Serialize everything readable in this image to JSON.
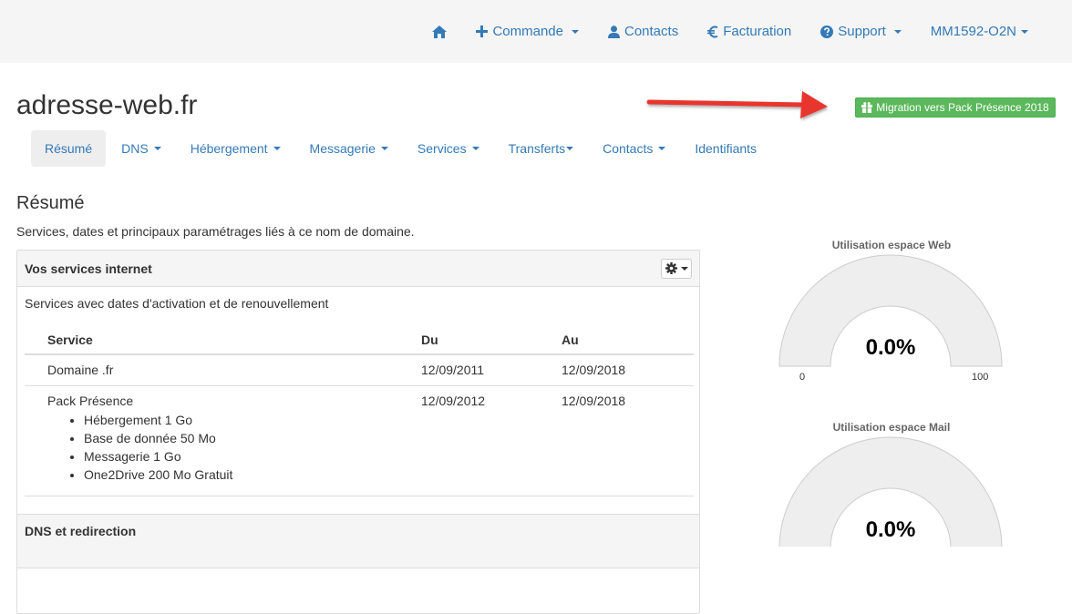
{
  "navbar": {
    "items": [
      {
        "label": "",
        "icon": "home-icon"
      },
      {
        "label": "Commande",
        "icon": "plus-icon",
        "dropdown": true
      },
      {
        "label": "Contacts",
        "icon": "user-icon"
      },
      {
        "label": "Facturation",
        "icon": "euro-icon"
      },
      {
        "label": "Support",
        "icon": "question-circle-icon",
        "dropdown": true
      },
      {
        "label": "MM1592-O2N",
        "dropdown": true
      }
    ]
  },
  "domain": {
    "title": "adresse-web.fr",
    "migration_button": "Migration vers Pack Présence 2018"
  },
  "tabs": [
    {
      "label": "Résumé",
      "active": true
    },
    {
      "label": "DNS",
      "dropdown": true
    },
    {
      "label": "Hébergement",
      "dropdown": true
    },
    {
      "label": "Messagerie",
      "dropdown": true
    },
    {
      "label": "Services",
      "dropdown": true
    },
    {
      "label": "Transferts",
      "dropdown": true
    },
    {
      "label": "Contacts",
      "dropdown": true
    },
    {
      "label": "Identifiants"
    }
  ],
  "summary": {
    "title": "Résumé",
    "description": "Services, dates et principaux paramétrages liés à ce nom de domaine."
  },
  "services_panel": {
    "title": "Vos services internet",
    "description": "Services avec dates d'activation et de renouvellement",
    "columns": [
      "Service",
      "Du",
      "Au"
    ],
    "rows": [
      {
        "service": "Domaine .fr",
        "du": "12/09/2011",
        "au": "12/09/2018",
        "items": []
      },
      {
        "service": "Pack Présence",
        "du": "12/09/2012",
        "au": "12/09/2018",
        "items": [
          "Hébergement 1 Go",
          "Base de donnée 50 Mo",
          "Messagerie 1 Go",
          "One2Drive 200 Mo Gratuit"
        ]
      }
    ]
  },
  "dns_panel": {
    "title": "DNS et redirection"
  },
  "gauges": [
    {
      "title": "Utilisation espace Web",
      "value": "0.0%",
      "value_num": 0,
      "min": "0",
      "max": "100"
    },
    {
      "title": "Utilisation espace Mail",
      "value": "0.0%",
      "value_num": 0
    }
  ],
  "colors": {
    "link": "#337ab7",
    "success": "#5cb85c",
    "arrow": "#e8342e",
    "gauge_fill": "#eeeeee",
    "gauge_stroke": "#cccccc"
  }
}
